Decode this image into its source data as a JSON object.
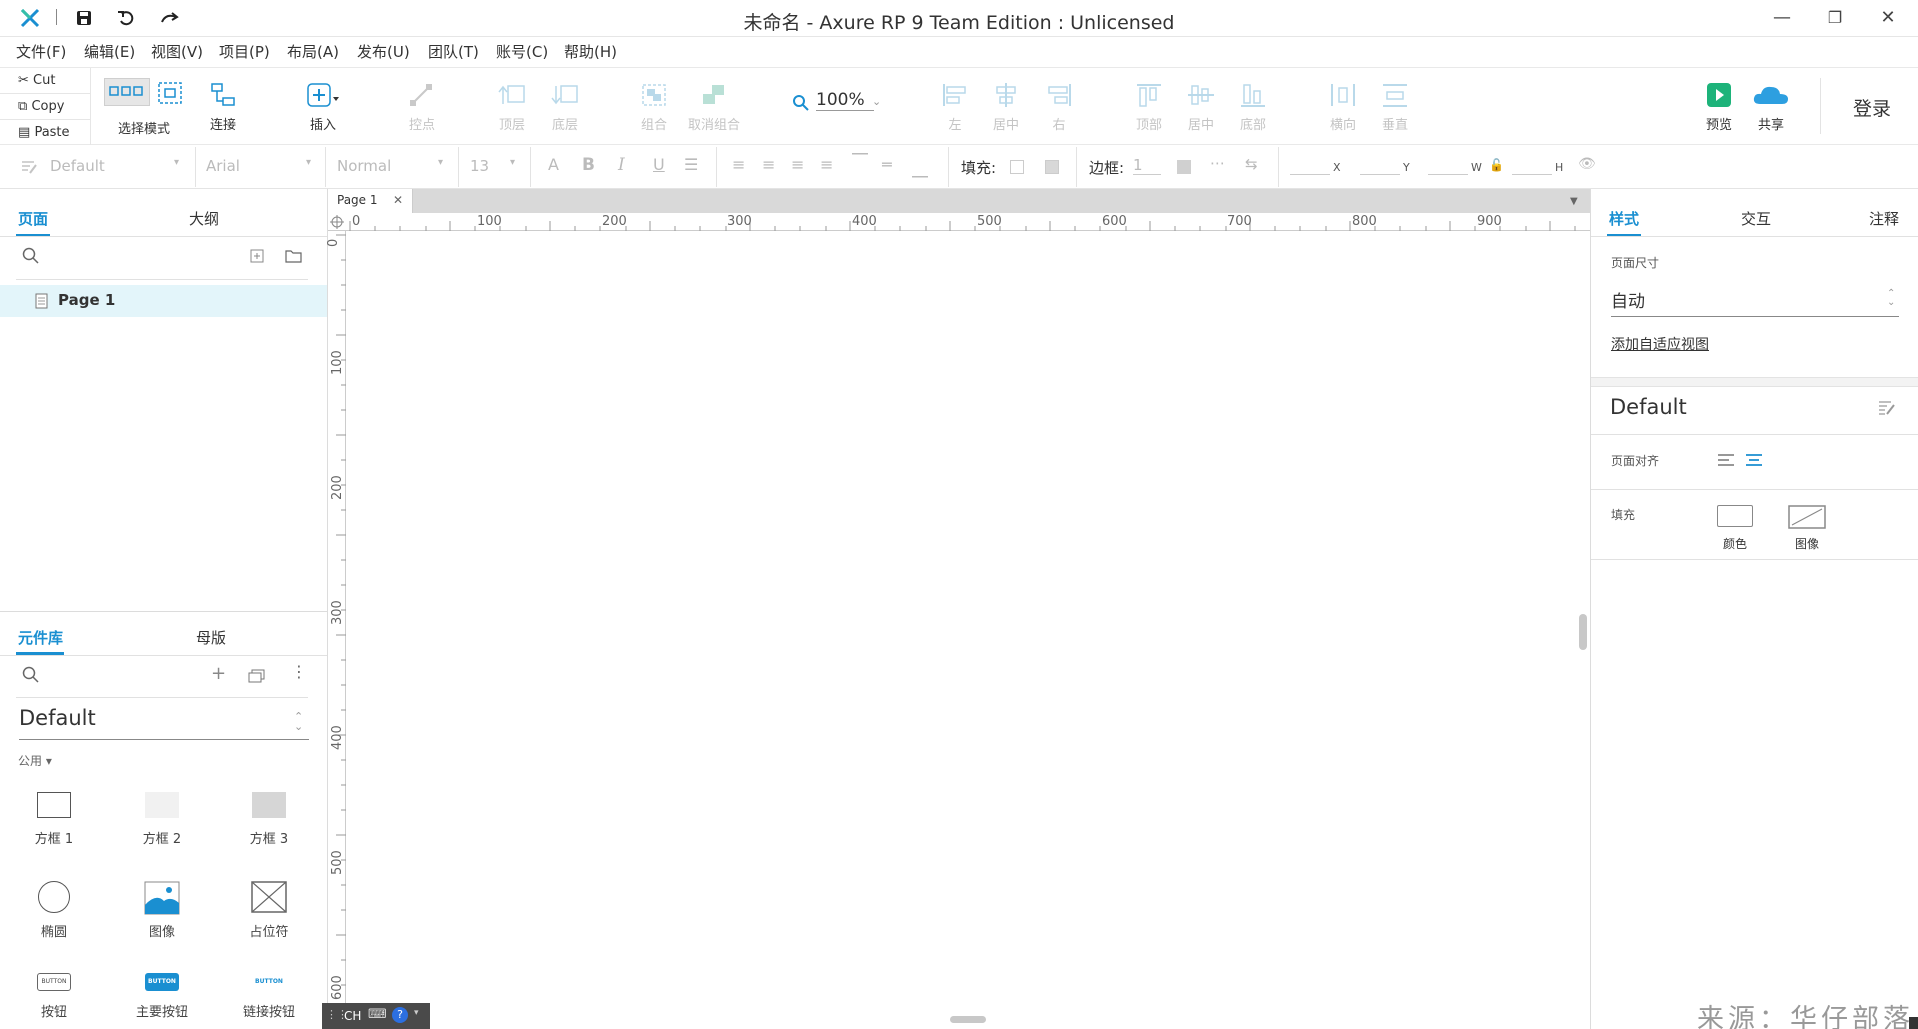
{
  "window": {
    "title": "未命名 - Axure RP 9 Team Edition : Unlicensed"
  },
  "menu": [
    "文件(F)",
    "编辑(E)",
    "视图(V)",
    "项目(P)",
    "布局(A)",
    "发布(U)",
    "团队(T)",
    "账号(C)",
    "帮助(H)"
  ],
  "clipboard": {
    "cut": "Cut",
    "copy": "Copy",
    "paste": "Paste"
  },
  "toolbar": {
    "select_mode": "选择模式",
    "connect": "连接",
    "insert": "插入",
    "points": "控点",
    "top_layer": "顶层",
    "bottom_layer": "底层",
    "group": "组合",
    "ungroup": "取消组合",
    "zoom": "100%",
    "align_left": "左",
    "align_center": "居中",
    "align_right": "右",
    "align_top": "顶部",
    "align_middle": "居中",
    "align_bottom": "底部",
    "distribute_h": "横向",
    "distribute_v": "垂直",
    "preview": "预览",
    "share": "共享",
    "login": "登录"
  },
  "format": {
    "style": "Default",
    "font": "Arial",
    "weight": "Normal",
    "size": "13",
    "fill_label": "填充:",
    "border_label": "边框:",
    "border_value": "1",
    "x": "X",
    "y": "Y",
    "w": "W",
    "h": "H"
  },
  "left_panel": {
    "tabs": [
      "页面",
      "大纲"
    ],
    "pages": [
      {
        "name": "Page 1"
      }
    ],
    "lib_tabs": [
      "元件库",
      "母版"
    ],
    "library": "Default",
    "category": "公用 ▾",
    "widgets": [
      "方框 1",
      "方框 2",
      "方框 3",
      "椭圆",
      "图像",
      "占位符",
      "按钮",
      "主要按钮",
      "链接按钮"
    ]
  },
  "canvas": {
    "tab": "Page 1",
    "ruler_x": [
      "0",
      "100",
      "200",
      "300",
      "400",
      "500",
      "600",
      "700",
      "800",
      "900"
    ],
    "ruler_y": [
      "0",
      "100",
      "200",
      "300",
      "400",
      "500",
      "600"
    ]
  },
  "right_panel": {
    "tabs": [
      "样式",
      "交互",
      "注释"
    ],
    "page_size_label": "页面尺寸",
    "page_size_value": "自动",
    "add_adaptive": "添加自适应视图",
    "style_name": "Default",
    "page_align_label": "页面对齐",
    "fill_label": "填充",
    "fill_color": "颜色",
    "fill_image": "图像"
  },
  "ime": {
    "lang": "CH"
  },
  "watermark": "来源：华仔部落",
  "colors": {
    "accent": "#1a8fd1",
    "preview": "#1db37a",
    "share": "#2d9fe0"
  }
}
